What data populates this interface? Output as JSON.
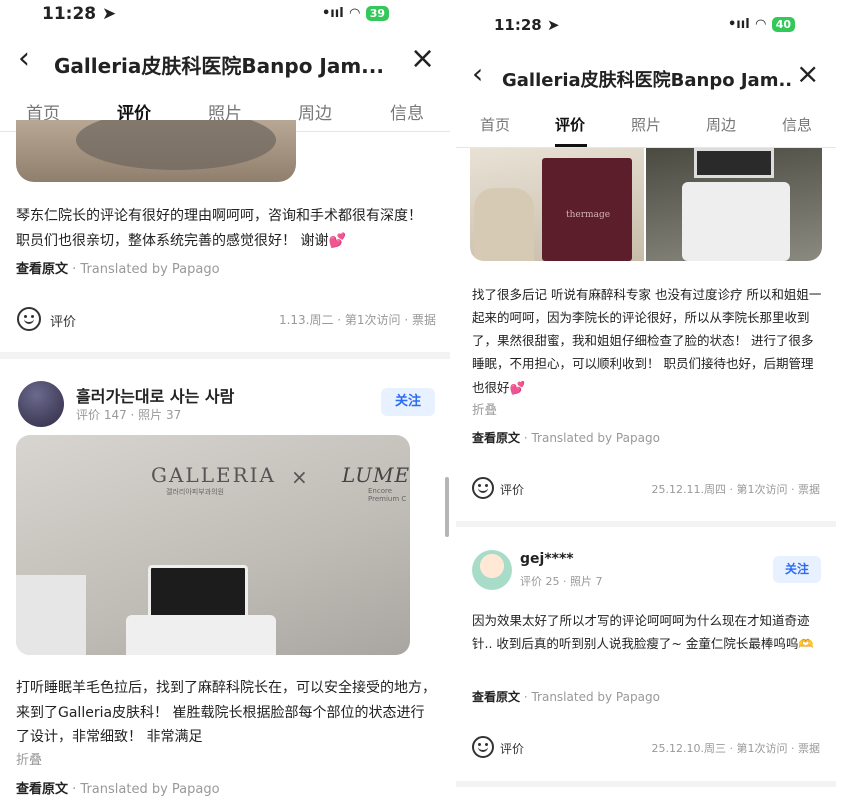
{
  "status": {
    "time": "11:28",
    "signal": "•ııl",
    "left_battery": "39",
    "right_battery": "40"
  },
  "header": {
    "title_left": "Galleria皮肤科医院Banpo Jam...",
    "title_right": "Galleria皮肤科医院Banpo Jam..."
  },
  "tabs": [
    {
      "label": "首页"
    },
    {
      "label": "评价"
    },
    {
      "label": "照片"
    },
    {
      "label": "周边"
    },
    {
      "label": "信息"
    }
  ],
  "left": {
    "review1": {
      "text": "琴东仁院长的评论有很好的理由啊呵呵，咨询和手术都很有深度！ 职员们也很亲切，整体系统完善的感觉很好！ 谢谢💕",
      "view_original": "查看原文",
      "translated": "· Translated by Papago",
      "eval_label": "评价",
      "date": "1.13.周二 · 第1次访问 · 票据"
    },
    "review2": {
      "user": "흘러가는대로 사는 사람",
      "stats": "评价 147 · 照片 37",
      "follow": "关注",
      "image_brand1": "GALLERIA",
      "image_brand1_sub": "갤러리아피부과의원",
      "image_x": "×",
      "image_brand2": "LUMEN",
      "image_brand2_sub": "Encore Premium C",
      "text": "打听睡眠羊毛色拉后，找到了麻醉科院长在，可以安全接受的地方，来到了Galleria皮肤科！ 崔胜载院长根据脸部每个部位的状态进行了设计，非常细致！ 非常满足",
      "fold": "折叠",
      "view_original": "查看原文",
      "translated": "· Translated by Papago"
    }
  },
  "right": {
    "review1": {
      "thermage": "thermage",
      "text": "找了很多后记 听说有麻醉科专家 也没有过度诊疗 所以和姐姐一起来的呵呵，因为李院长的评论很好，所以从李院长那里收到了，果然很甜蜜，我和姐姐仔细检查了脸的状态！ 进行了很多睡眠，不用担心，可以顺利收到！ 职员们接待也好，后期管理也很好💕",
      "fold": "折叠",
      "view_original": "查看原文",
      "translated": "· Translated by Papago",
      "eval_label": "评价",
      "date": "25.12.11.周四 · 第1次访问 · 票据"
    },
    "review2": {
      "user": "gej****",
      "stats": "评价 25 · 照片 7",
      "follow": "关注",
      "text": "因为效果太好了所以才写的评论呵呵呵为什么现在才知道奇迹针.. 收到后真的听到别人说我脸瘦了~ 金童仁院长最棒呜呜🫶",
      "view_original": "查看原文",
      "translated": "· Translated by Papago",
      "eval_label": "评价",
      "date": "25.12.10.周三 · 第1次访问 · 票据"
    }
  }
}
